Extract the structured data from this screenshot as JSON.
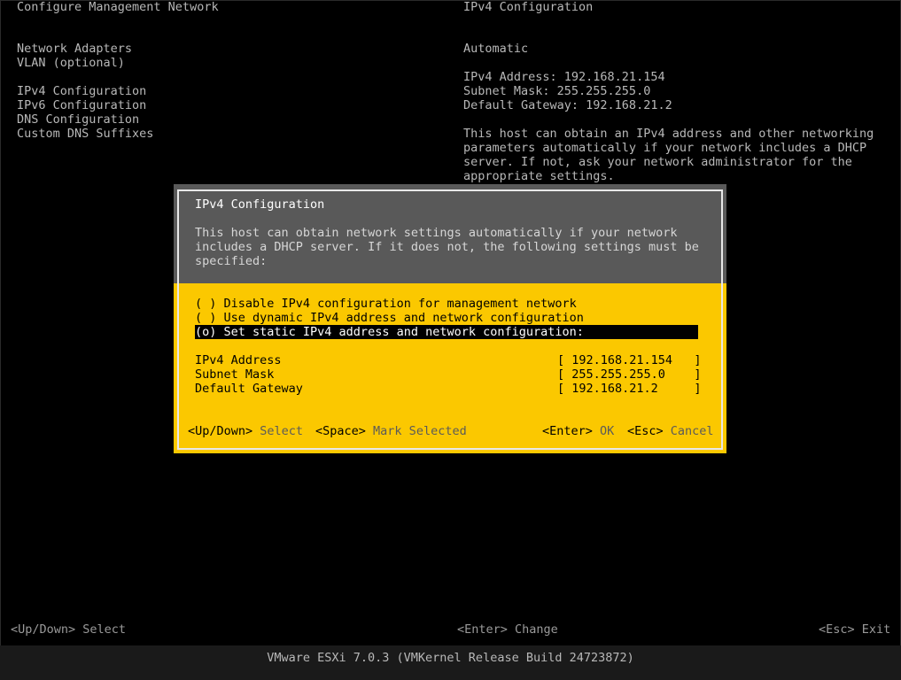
{
  "left_title": "Configure Management Network",
  "right_title": "IPv4 Configuration",
  "menu": [
    "Network Adapters",
    "VLAN (optional)",
    "IPv4 Configuration",
    "IPv6 Configuration",
    "DNS Configuration",
    "Custom DNS Suffixes"
  ],
  "detail": {
    "mode": "Automatic",
    "ipv4_address": "IPv4 Address: 192.168.21.154",
    "subnet_mask": "Subnet Mask: 255.255.255.0",
    "gateway": "Default Gateway: 192.168.21.2",
    "desc": [
      "This host can obtain an IPv4 address and other networking",
      "parameters automatically if your network includes a DHCP",
      "server. If not, ask your network administrator for the",
      "appropriate settings."
    ]
  },
  "dialog": {
    "title": "IPv4 Configuration",
    "text": [
      "This host can obtain network settings automatically if your network",
      "includes a DHCP server. If it does not, the following settings must be",
      "specified:"
    ],
    "options": [
      "( ) Disable IPv4 configuration for management network",
      "( ) Use dynamic IPv4 address and network configuration",
      "(o) Set static IPv4 address and network configuration:"
    ],
    "fields": [
      {
        "label": "IPv4 Address",
        "value": "[ 192.168.21.154   ]"
      },
      {
        "label": "Subnet Mask",
        "value": "[ 255.255.255.0    ]"
      },
      {
        "label": "Default Gateway",
        "value": "[ 192.168.21.2     ]"
      }
    ],
    "hints": {
      "updown_key": "<Up/Down>",
      "updown_label": "Select",
      "space_key": "<Space>",
      "space_label": "Mark Selected",
      "enter_key": "<Enter>",
      "enter_label": "OK",
      "esc_key": "<Esc>",
      "esc_label": "Cancel"
    }
  },
  "footer": {
    "left": "<Up/Down> Select",
    "center": "<Enter> Change",
    "right": "<Esc> Exit"
  },
  "status": "VMware ESXi 7.0.3 (VMKernel Release Build 24723872)",
  "colors": {
    "dialog_body": "#fbc800",
    "dialog_header": "#595959",
    "background": "#000000"
  }
}
